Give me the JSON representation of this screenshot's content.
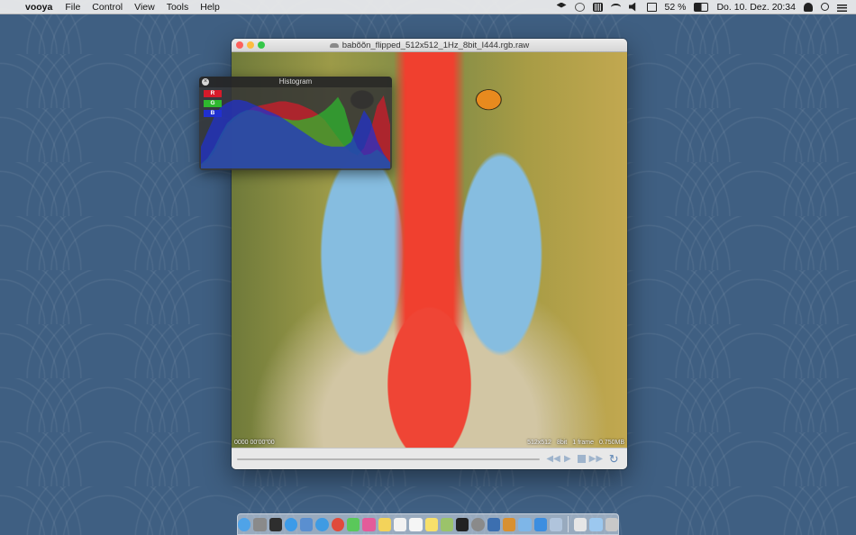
{
  "menubar": {
    "app_name": "vooya",
    "menus": [
      "File",
      "Control",
      "View",
      "Tools",
      "Help"
    ],
    "battery_percent": "52 %",
    "clock": "Do. 10. Dez.  20:34"
  },
  "window": {
    "title": "babõõn_flipped_512x512_1Hz_8bit_I444.rgb.raw"
  },
  "viewer": {
    "timecode": "0000 00'00\"00",
    "resolution": "512x512",
    "bitdepth": "8bit",
    "frames": "1 frame",
    "size": "0.750MB"
  },
  "histogram": {
    "title": "Histogram",
    "channels": [
      "R",
      "G",
      "B"
    ]
  },
  "chart_data": {
    "type": "area",
    "title": "Histogram",
    "series": [
      {
        "name": "R",
        "color": "#d61a2a",
        "values": [
          4,
          10,
          22,
          40,
          58,
          66,
          74,
          78,
          84,
          86,
          88,
          90,
          92,
          92,
          90,
          88,
          84,
          80,
          74,
          66,
          54,
          42,
          30,
          22,
          18,
          28,
          52,
          86,
          100,
          60
        ]
      },
      {
        "name": "G",
        "color": "#2eb82e",
        "values": [
          6,
          14,
          28,
          46,
          62,
          70,
          76,
          80,
          80,
          78,
          74,
          72,
          70,
          68,
          66,
          66,
          68,
          70,
          74,
          80,
          88,
          98,
          82,
          50,
          28,
          18,
          20,
          26,
          18,
          8
        ]
      },
      {
        "name": "B",
        "color": "#2030d0",
        "values": [
          30,
          50,
          70,
          84,
          90,
          94,
          94,
          92,
          88,
          84,
          80,
          76,
          72,
          66,
          60,
          54,
          48,
          42,
          36,
          32,
          30,
          30,
          30,
          36,
          58,
          80,
          66,
          38,
          20,
          8
        ]
      }
    ]
  },
  "dock": {
    "icons": [
      "finder",
      "launchpad",
      "dashboard",
      "app-store",
      "preview",
      "safari",
      "chrome",
      "messages",
      "itunes",
      "notes",
      "calendar",
      "text-editor",
      "stickies",
      "photos",
      "terminal",
      "system-preferences",
      "vooya",
      "unknown",
      "mail",
      "xcode",
      "cloud",
      "documents",
      "downloads",
      "trash"
    ],
    "colors": [
      "#4fa3e8",
      "#8a8a8a",
      "#2e2e2e",
      "#3c9be8",
      "#5a8fd0",
      "#3f9be3",
      "#e04a3b",
      "#5ac85a",
      "#e45b9a",
      "#f3d35a",
      "#f2f2f2",
      "#f5f5f5",
      "#f7e06a",
      "#9bc36a",
      "#222222",
      "#8a8a8a",
      "#3c6fb0",
      "#d89030",
      "#7eb6e8",
      "#3c8ee0",
      "#b0c4dc",
      "#e6e6e6",
      "#9cc8ef",
      "#c8c8c8"
    ]
  }
}
